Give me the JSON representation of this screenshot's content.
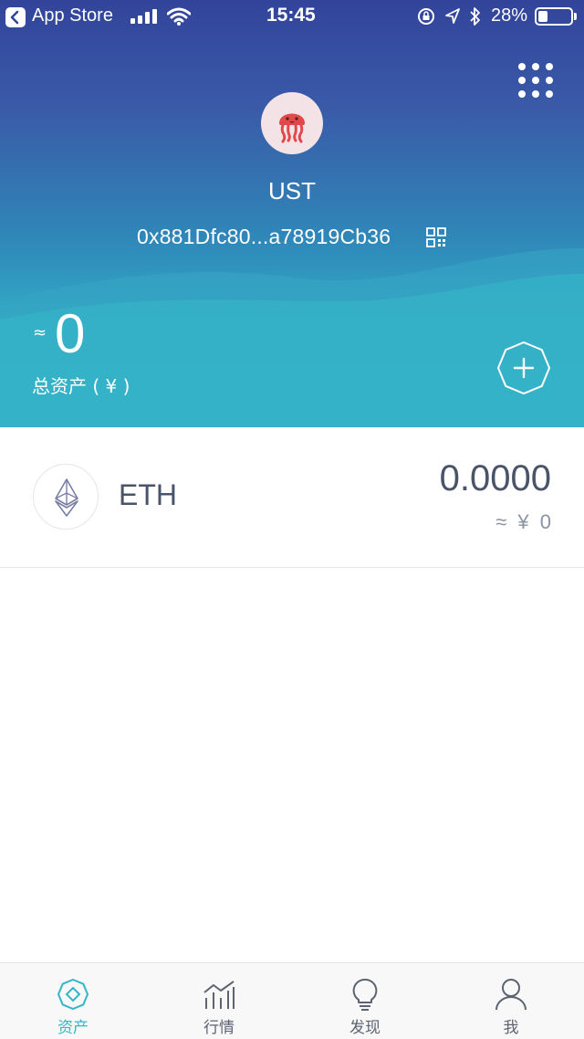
{
  "status_bar": {
    "back_app": "App Store",
    "time": "15:45",
    "battery_percent": "28%",
    "battery_level": 0.28
  },
  "wallet": {
    "name": "UST",
    "address": "0x881Dfc80...a78919Cb36"
  },
  "summary": {
    "approx_symbol": "≈",
    "total_value": "0",
    "total_label": "总资产 ( ¥ )"
  },
  "assets": [
    {
      "symbol": "ETH",
      "balance": "0.0000",
      "fiat": "≈ ¥ 0"
    }
  ],
  "tabbar": {
    "tabs": [
      {
        "label": "资产",
        "icon": "assets-icon",
        "active": true
      },
      {
        "label": "行情",
        "icon": "market-chart-icon",
        "active": false
      },
      {
        "label": "发现",
        "icon": "lightbulb-icon",
        "active": false
      },
      {
        "label": "我",
        "icon": "profile-icon",
        "active": false
      }
    ]
  },
  "colors": {
    "accent": "#34b6c8",
    "header_top": "#32449a",
    "header_bottom": "#34b8c9",
    "text_dark": "#4a5468",
    "text_muted": "#8a93a3"
  }
}
